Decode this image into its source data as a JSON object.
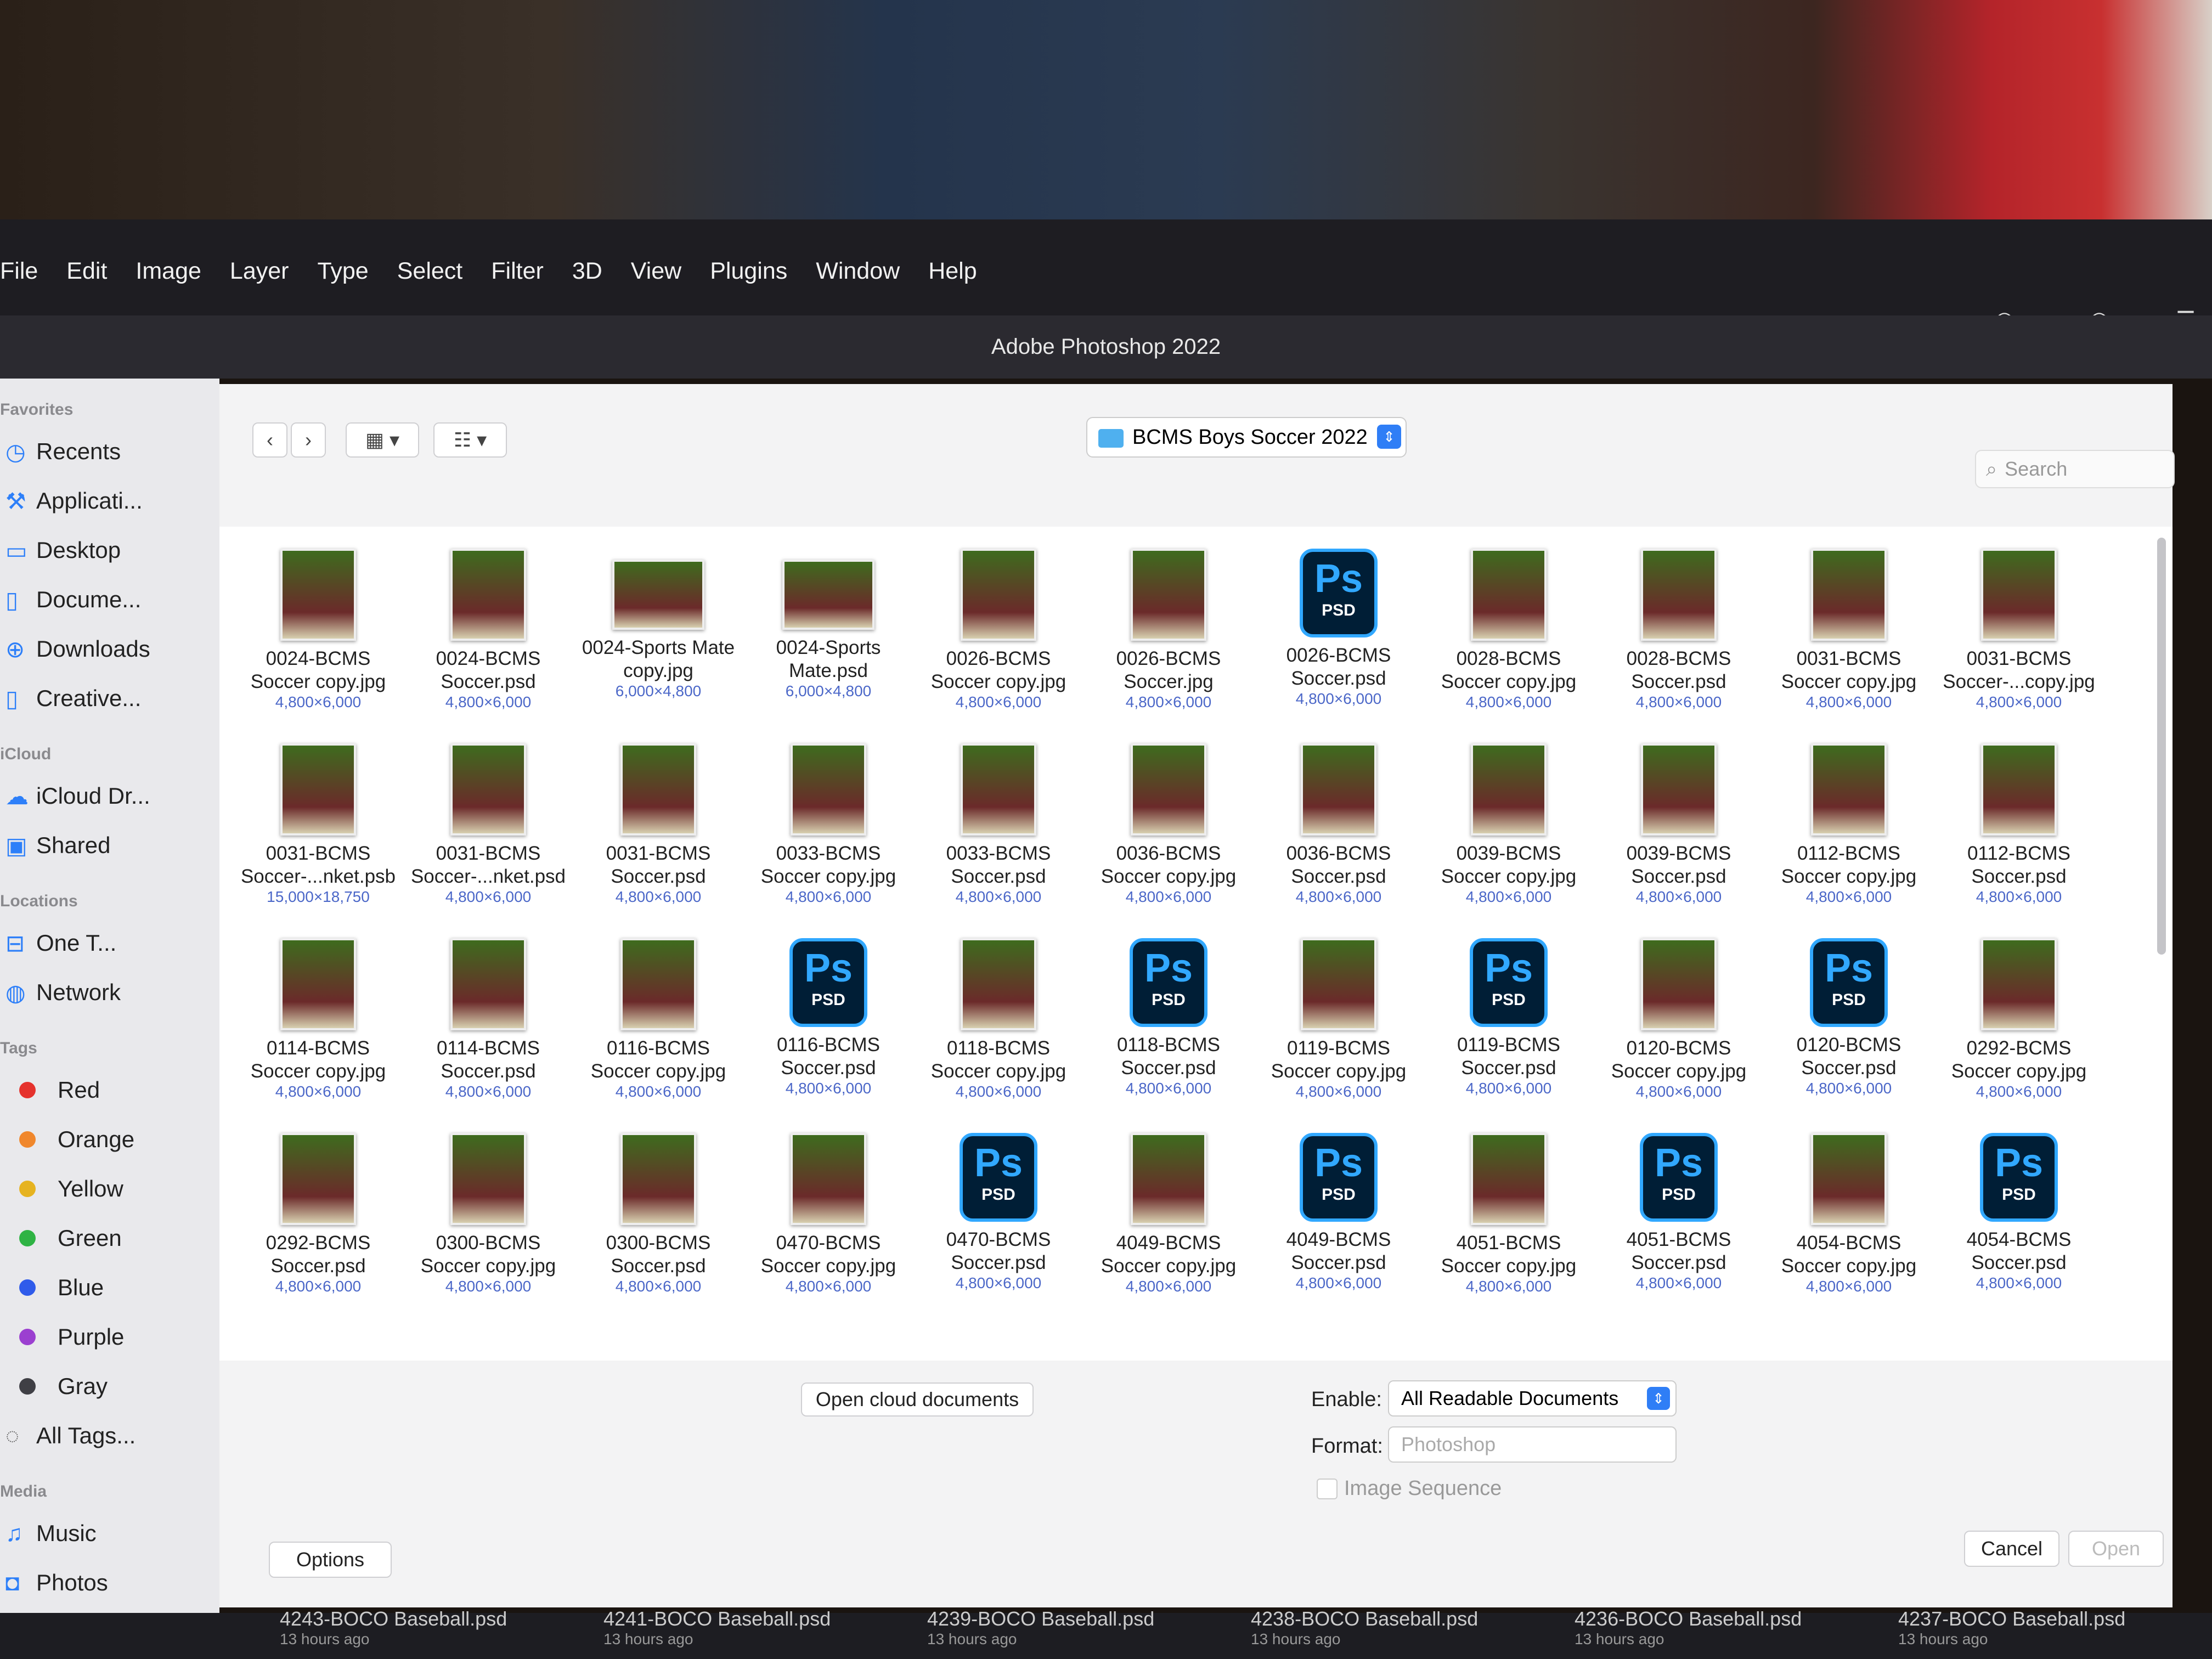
{
  "menubar": {
    "items": [
      "File",
      "Edit",
      "Image",
      "Layer",
      "Type",
      "Select",
      "Filter",
      "3D",
      "View",
      "Plugins",
      "Window",
      "Help"
    ]
  },
  "window_title": "Adobe Photoshop 2022",
  "sidebar": {
    "favorites_header": "Favorites",
    "favorites": [
      {
        "label": "Recents",
        "icon": "clock-icon"
      },
      {
        "label": "Applicati...",
        "icon": "applications-icon"
      },
      {
        "label": "Desktop",
        "icon": "desktop-icon"
      },
      {
        "label": "Docume...",
        "icon": "document-icon"
      },
      {
        "label": "Downloads",
        "icon": "download-icon"
      },
      {
        "label": "Creative...",
        "icon": "file-icon"
      }
    ],
    "icloud_header": "iCloud",
    "icloud": [
      {
        "label": "iCloud Dr...",
        "icon": "cloud-icon"
      },
      {
        "label": "Shared",
        "icon": "shared-folder-icon"
      }
    ],
    "locations_header": "Locations",
    "locations": [
      {
        "label": "One T...",
        "icon": "drive-icon"
      },
      {
        "label": "Network",
        "icon": "globe-icon"
      }
    ],
    "tags_header": "Tags",
    "tags": [
      {
        "label": "Red",
        "color": "#e5322d"
      },
      {
        "label": "Orange",
        "color": "#f0872c"
      },
      {
        "label": "Yellow",
        "color": "#e6b320"
      },
      {
        "label": "Green",
        "color": "#2fb344"
      },
      {
        "label": "Blue",
        "color": "#2f5bea"
      },
      {
        "label": "Purple",
        "color": "#9b3fd0"
      },
      {
        "label": "Gray",
        "color": "#3f3f45"
      }
    ],
    "all_tags": "All Tags...",
    "media_header": "Media",
    "media": [
      {
        "label": "Music",
        "icon": "music-icon"
      },
      {
        "label": "Photos",
        "icon": "camera-icon"
      }
    ]
  },
  "toolbar": {
    "path_folder": "BCMS Boys Soccer 2022",
    "search_placeholder": "Search"
  },
  "files": [
    {
      "name": "0024-BCMS Soccer copy.jpg",
      "dim": "4,800×6,000",
      "kind": "photo"
    },
    {
      "name": "0024-BCMS Soccer.psd",
      "dim": "4,800×6,000",
      "kind": "photo"
    },
    {
      "name": "0024-Sports Mate copy.jpg",
      "dim": "6,000×4,800",
      "kind": "wide"
    },
    {
      "name": "0024-Sports Mate.psd",
      "dim": "6,000×4,800",
      "kind": "wide"
    },
    {
      "name": "0026-BCMS Soccer copy.jpg",
      "dim": "4,800×6,000",
      "kind": "photo"
    },
    {
      "name": "0026-BCMS Soccer.jpg",
      "dim": "4,800×6,000",
      "kind": "photo"
    },
    {
      "name": "0026-BCMS Soccer.psd",
      "dim": "4,800×6,000",
      "kind": "psd"
    },
    {
      "name": "0028-BCMS Soccer copy.jpg",
      "dim": "4,800×6,000",
      "kind": "photo"
    },
    {
      "name": "0028-BCMS Soccer.psd",
      "dim": "4,800×6,000",
      "kind": "photo"
    },
    {
      "name": "0031-BCMS Soccer copy.jpg",
      "dim": "4,800×6,000",
      "kind": "photo"
    },
    {
      "name": "0031-BCMS Soccer-...copy.jpg",
      "dim": "4,800×6,000",
      "kind": "photo"
    },
    {
      "name": "0031-BCMS Soccer-...nket.psb",
      "dim": "15,000×18,750",
      "kind": "photo"
    },
    {
      "name": "0031-BCMS Soccer-...nket.psd",
      "dim": "4,800×6,000",
      "kind": "photo"
    },
    {
      "name": "0031-BCMS Soccer.psd",
      "dim": "4,800×6,000",
      "kind": "photo"
    },
    {
      "name": "0033-BCMS Soccer copy.jpg",
      "dim": "4,800×6,000",
      "kind": "photo"
    },
    {
      "name": "0033-BCMS Soccer.psd",
      "dim": "4,800×6,000",
      "kind": "photo"
    },
    {
      "name": "0036-BCMS Soccer copy.jpg",
      "dim": "4,800×6,000",
      "kind": "photo"
    },
    {
      "name": "0036-BCMS Soccer.psd",
      "dim": "4,800×6,000",
      "kind": "photo"
    },
    {
      "name": "0039-BCMS Soccer copy.jpg",
      "dim": "4,800×6,000",
      "kind": "photo"
    },
    {
      "name": "0039-BCMS Soccer.psd",
      "dim": "4,800×6,000",
      "kind": "photo"
    },
    {
      "name": "0112-BCMS Soccer copy.jpg",
      "dim": "4,800×6,000",
      "kind": "photo"
    },
    {
      "name": "0112-BCMS Soccer.psd",
      "dim": "4,800×6,000",
      "kind": "photo"
    },
    {
      "name": "0114-BCMS Soccer copy.jpg",
      "dim": "4,800×6,000",
      "kind": "photo"
    },
    {
      "name": "0114-BCMS Soccer.psd",
      "dim": "4,800×6,000",
      "kind": "photo"
    },
    {
      "name": "0116-BCMS Soccer copy.jpg",
      "dim": "4,800×6,000",
      "kind": "photo"
    },
    {
      "name": "0116-BCMS Soccer.psd",
      "dim": "4,800×6,000",
      "kind": "psd"
    },
    {
      "name": "0118-BCMS Soccer copy.jpg",
      "dim": "4,800×6,000",
      "kind": "photo"
    },
    {
      "name": "0118-BCMS Soccer.psd",
      "dim": "4,800×6,000",
      "kind": "psd"
    },
    {
      "name": "0119-BCMS Soccer copy.jpg",
      "dim": "4,800×6,000",
      "kind": "photo"
    },
    {
      "name": "0119-BCMS Soccer.psd",
      "dim": "4,800×6,000",
      "kind": "psd"
    },
    {
      "name": "0120-BCMS Soccer copy.jpg",
      "dim": "4,800×6,000",
      "kind": "photo"
    },
    {
      "name": "0120-BCMS Soccer.psd",
      "dim": "4,800×6,000",
      "kind": "psd"
    },
    {
      "name": "0292-BCMS Soccer copy.jpg",
      "dim": "4,800×6,000",
      "kind": "photo"
    },
    {
      "name": "0292-BCMS Soccer.psd",
      "dim": "4,800×6,000",
      "kind": "photo"
    },
    {
      "name": "0300-BCMS Soccer copy.jpg",
      "dim": "4,800×6,000",
      "kind": "photo"
    },
    {
      "name": "0300-BCMS Soccer.psd",
      "dim": "4,800×6,000",
      "kind": "photo"
    },
    {
      "name": "0470-BCMS Soccer copy.jpg",
      "dim": "4,800×6,000",
      "kind": "photo"
    },
    {
      "name": "0470-BCMS Soccer.psd",
      "dim": "4,800×6,000",
      "kind": "psd"
    },
    {
      "name": "4049-BCMS Soccer copy.jpg",
      "dim": "4,800×6,000",
      "kind": "photo"
    },
    {
      "name": "4049-BCMS Soccer.psd",
      "dim": "4,800×6,000",
      "kind": "psd"
    },
    {
      "name": "4051-BCMS Soccer copy.jpg",
      "dim": "4,800×6,000",
      "kind": "photo"
    },
    {
      "name": "4051-BCMS Soccer.psd",
      "dim": "4,800×6,000",
      "kind": "psd"
    },
    {
      "name": "4054-BCMS Soccer copy.jpg",
      "dim": "4,800×6,000",
      "kind": "photo"
    },
    {
      "name": "4054-BCMS Soccer.psd",
      "dim": "4,800×6,000",
      "kind": "psd"
    }
  ],
  "psd_icon": {
    "ps": "Ps",
    "label": "PSD"
  },
  "cloud_button": "Open cloud documents",
  "enable": {
    "label": "Enable:",
    "value": "All Readable Documents"
  },
  "format": {
    "label": "Format:",
    "value": "Photoshop"
  },
  "image_sequence": "Image Sequence",
  "buttons": {
    "options": "Options",
    "cancel": "Cancel",
    "open": "Open"
  },
  "background_files": [
    {
      "name": "4243-BOCO Baseball.psd",
      "time": "13 hours ago"
    },
    {
      "name": "4241-BOCO Baseball.psd",
      "time": "13 hours ago"
    },
    {
      "name": "4239-BOCO Baseball.psd",
      "time": "13 hours ago"
    },
    {
      "name": "4238-BOCO Baseball.psd",
      "time": "13 hours ago"
    },
    {
      "name": "4236-BOCO Baseball.psd",
      "time": "13 hours ago"
    },
    {
      "name": "4237-BOCO Baseball.psd",
      "time": "13 hours ago"
    }
  ]
}
